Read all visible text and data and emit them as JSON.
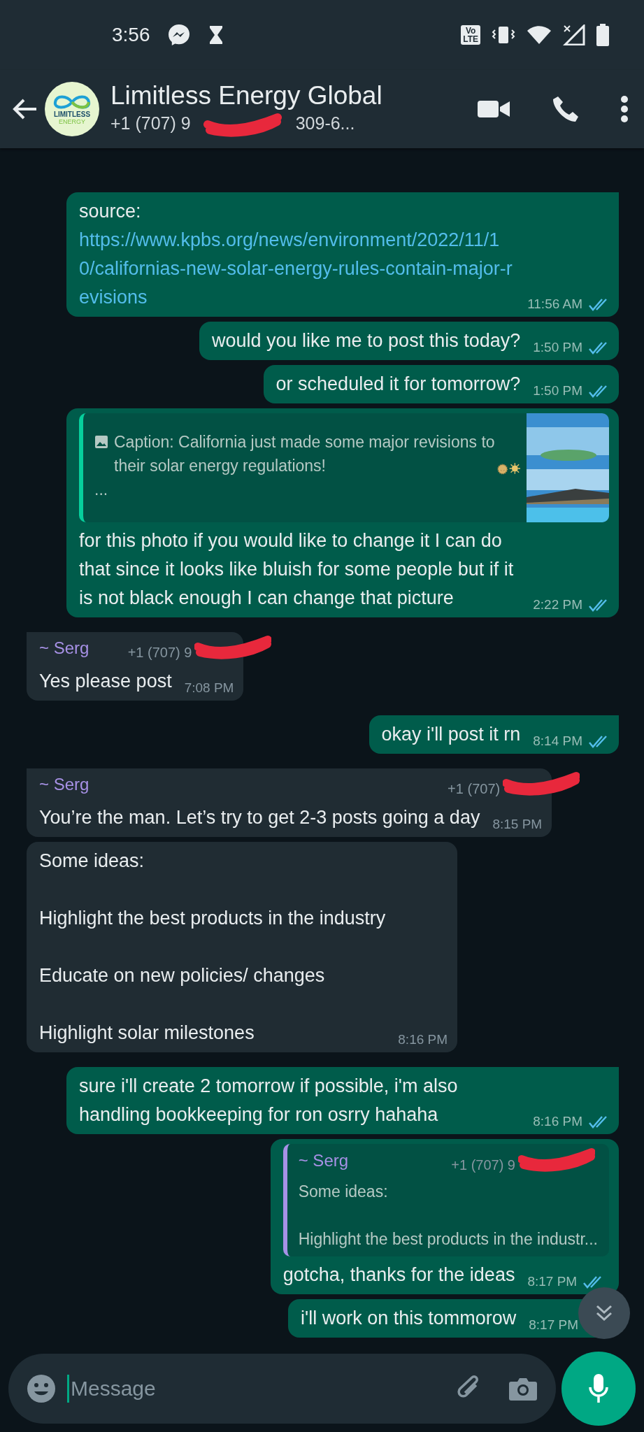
{
  "status_bar": {
    "time": "3:56",
    "volte": [
      "Vo",
      "LTE"
    ]
  },
  "chat": {
    "title": "Limitless Energy Global",
    "avatar_text": [
      "LIMITLESS",
      "ENERGY"
    ],
    "subtitle": [
      {
        "text": "+1 (707) 9",
        "redacted": true
      },
      {
        "text": "309-6..."
      }
    ]
  },
  "messages": [
    {
      "kind": "link",
      "outgoing": true,
      "prefix": "source:",
      "link": "https://www.kpbs.org/news/environment/2022/11/10/californias-new-solar-energy-rules-contain-major-revisions",
      "time": "11:56 AM",
      "read": true
    },
    {
      "kind": "text",
      "outgoing": true,
      "text": "would you like me to post this today?",
      "time": "1:50 PM",
      "read": true
    },
    {
      "kind": "text",
      "outgoing": true,
      "text": "or scheduled it for tomorrow?",
      "time": "1:50 PM",
      "read": true
    },
    {
      "kind": "quote_media",
      "outgoing": true,
      "quote": {
        "caption": "Caption: California just made some major revisions to their solar energy  regulations!",
        "more": "..."
      },
      "text": "for this photo if you would like to change it I can do that since it looks like bluish for some people but if it is not black enough I can change that picture",
      "time": "2:22 PM",
      "read": true
    },
    {
      "kind": "text",
      "outgoing": false,
      "sender": "~ Serg",
      "phone": {
        "text": "+1 (707) 9",
        "redacted": true
      },
      "text": "Yes please post",
      "time": "7:08 PM"
    },
    {
      "kind": "text",
      "outgoing": true,
      "text": "okay i'll post it rn",
      "time": "8:14 PM",
      "read": true
    },
    {
      "kind": "text",
      "outgoing": false,
      "sender": "~ Serg",
      "phone": {
        "text": "+1 (707)",
        "redacted": true
      },
      "text": "You’re the man. Let’s try to get 2-3 posts going a day",
      "time": "8:15 PM"
    },
    {
      "kind": "text",
      "outgoing": false,
      "text": "Some ideas:\n\nHighlight the best products in the industry\n\nEducate on new policies/ changes\n\nHighlight solar milestones",
      "time": "8:16 PM"
    },
    {
      "kind": "text",
      "outgoing": true,
      "text": "sure i'll create 2 tomorrow if possible, i'm also handling bookkeeping for ron osrry hahaha",
      "time": "8:16 PM",
      "read": true
    },
    {
      "kind": "quote_reply",
      "outgoing": true,
      "quote": {
        "sender": "~ Serg",
        "phone": {
          "text": "+1 (707) 9",
          "redacted": true
        },
        "lines": [
          "Some ideas:",
          "Highlight the best products in the industr..."
        ]
      },
      "text": "gotcha, thanks for the ideas",
      "time": "8:17 PM",
      "read": true
    },
    {
      "kind": "text",
      "outgoing": true,
      "text": "i'll work on this tommorow",
      "time": "8:17 PM"
    }
  ],
  "composer": {
    "placeholder": "Message"
  }
}
